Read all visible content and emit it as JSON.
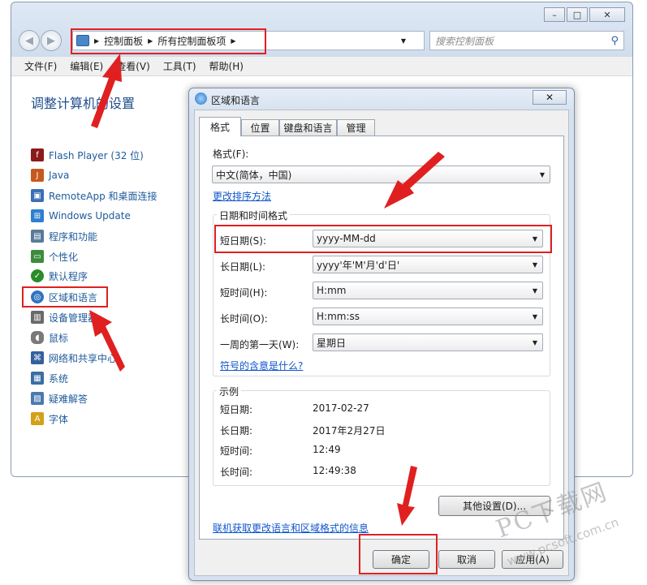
{
  "colors": {
    "annotation": "#e02020",
    "link": "#1155cc",
    "panel_link": "#1e5a9a",
    "title": "#1e4e8c"
  },
  "window": {
    "caption_buttons": [
      "–",
      "□",
      "✕"
    ],
    "address": {
      "segments": [
        "控制面板",
        "所有控制面板项"
      ],
      "icon": "control-panel-icon"
    },
    "search_placeholder": "搜索控制面板",
    "menu": [
      "文件(F)",
      "编辑(E)",
      "查看(V)",
      "工具(T)",
      "帮助(H)"
    ],
    "page_title": "调整计算机的设置",
    "items": [
      {
        "label": "Flash Player (32 位)",
        "icon": "flash-icon",
        "color": "#8b1a1a"
      },
      {
        "label": "Java",
        "icon": "java-icon",
        "color": "#c65a1e"
      },
      {
        "label": "RemoteApp 和桌面连接",
        "icon": "remoteapp-icon",
        "color": "#3b6fb6"
      },
      {
        "label": "Windows Update",
        "icon": "windows-update-icon",
        "color": "#2f7fd0"
      },
      {
        "label": "程序和功能",
        "icon": "programs-icon",
        "color": "#5a7a9a"
      },
      {
        "label": "个性化",
        "icon": "personalization-icon",
        "color": "#3d8c3d"
      },
      {
        "label": "默认程序",
        "icon": "default-programs-icon",
        "color": "#2a8c2a"
      },
      {
        "label": "区域和语言",
        "icon": "globe-icon",
        "color": "#2f74c0"
      },
      {
        "label": "设备管理器",
        "icon": "device-manager-icon",
        "color": "#6a6a6a"
      },
      {
        "label": "鼠标",
        "icon": "mouse-icon",
        "color": "#7a7a7a"
      },
      {
        "label": "网络和共享中心",
        "icon": "network-icon",
        "color": "#3560a0"
      },
      {
        "label": "系统",
        "icon": "system-icon",
        "color": "#3a6ea5"
      },
      {
        "label": "疑难解答",
        "icon": "troubleshoot-icon",
        "color": "#4a7ab0"
      },
      {
        "label": "字体",
        "icon": "fonts-icon",
        "color": "#d4a017"
      }
    ]
  },
  "dialog": {
    "title": "区域和语言",
    "close": "✕",
    "tabs": [
      "格式",
      "位置",
      "键盘和语言",
      "管理"
    ],
    "format_label": "格式(F):",
    "format_value": "中文(简体，中国)",
    "sort_link": "更改排序方法",
    "datetime_group": "日期和时间格式",
    "fields": [
      {
        "label": "短日期(S):",
        "value": "yyyy-MM-dd"
      },
      {
        "label": "长日期(L):",
        "value": "yyyy'年'M'月'd'日'"
      },
      {
        "label": "短时间(H):",
        "value": "H:mm"
      },
      {
        "label": "长时间(O):",
        "value": "H:mm:ss"
      },
      {
        "label": "一周的第一天(W):",
        "value": "星期日"
      }
    ],
    "symbols_link": "符号的含意是什么?",
    "examples_group": "示例",
    "examples": [
      {
        "label": "短日期:",
        "value": "2017-02-27"
      },
      {
        "label": "长日期:",
        "value": "2017年2月27日"
      },
      {
        "label": "短时间:",
        "value": "12:49"
      },
      {
        "label": "长时间:",
        "value": "12:49:38"
      }
    ],
    "other_settings": "其他设置(D)...",
    "online_link": "联机获取更改语言和区域格式的信息",
    "ok": "确定",
    "cancel": "取消",
    "apply": "应用(A)"
  },
  "watermark": {
    "text": "PC下载网",
    "url": "www.pcsoft.com.cn"
  }
}
